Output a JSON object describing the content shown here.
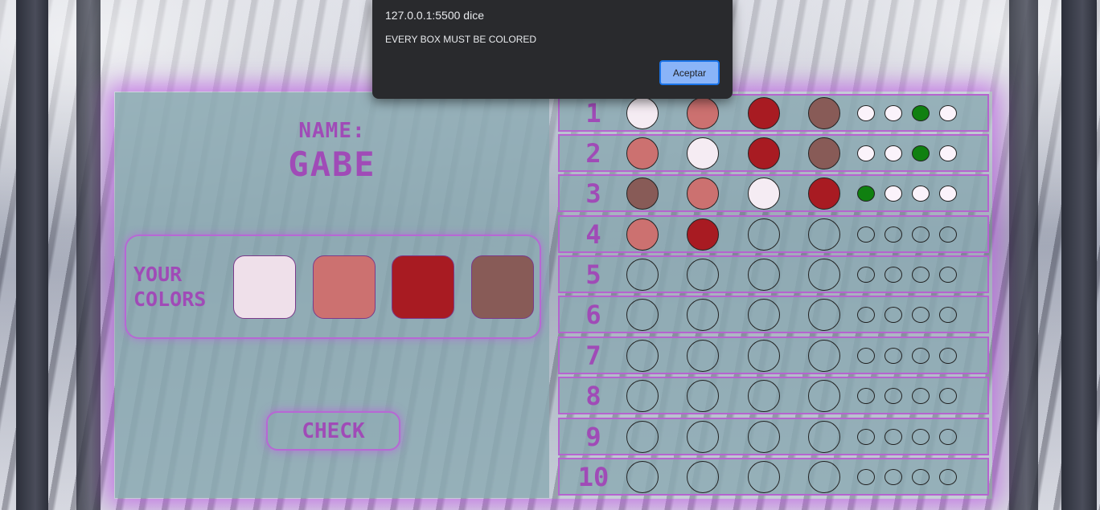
{
  "alert": {
    "title": "127.0.0.1:5500 dice",
    "message": "EVERY BOX MUST BE COLORED",
    "accept_label": "Aceptar"
  },
  "player": {
    "name_label": "NAME:",
    "name": "GABE"
  },
  "colors_panel": {
    "label_line1": "YOUR",
    "label_line2": "COLORS",
    "colors": [
      "#efe0ea",
      "#cc7170",
      "#a81b22",
      "#885b57"
    ]
  },
  "check_label": "CHECK",
  "palette": {
    "accent": "#a04bb7",
    "glow": "#be5ae6",
    "empty": "transparent",
    "white": "#f5ecf3",
    "pink": "#cc7170",
    "red": "#a81b22",
    "brown": "#885b57",
    "hint_white": "#fbf3fb",
    "hint_green": "#108010"
  },
  "rows": [
    {
      "num": "1",
      "pegs": [
        "white",
        "pink",
        "red",
        "brown"
      ],
      "hints": [
        "hint_white",
        "hint_white",
        "hint_green",
        "hint_white"
      ]
    },
    {
      "num": "2",
      "pegs": [
        "pink",
        "white",
        "red",
        "brown"
      ],
      "hints": [
        "hint_white",
        "hint_white",
        "hint_green",
        "hint_white"
      ]
    },
    {
      "num": "3",
      "pegs": [
        "brown",
        "pink",
        "white",
        "red"
      ],
      "hints": [
        "hint_green",
        "hint_white",
        "hint_white",
        "hint_white"
      ]
    },
    {
      "num": "4",
      "pegs": [
        "pink",
        "red",
        "empty",
        "empty"
      ],
      "hints": [
        "empty",
        "empty",
        "empty",
        "empty"
      ]
    },
    {
      "num": "5",
      "pegs": [
        "empty",
        "empty",
        "empty",
        "empty"
      ],
      "hints": [
        "empty",
        "empty",
        "empty",
        "empty"
      ]
    },
    {
      "num": "6",
      "pegs": [
        "empty",
        "empty",
        "empty",
        "empty"
      ],
      "hints": [
        "empty",
        "empty",
        "empty",
        "empty"
      ]
    },
    {
      "num": "7",
      "pegs": [
        "empty",
        "empty",
        "empty",
        "empty"
      ],
      "hints": [
        "empty",
        "empty",
        "empty",
        "empty"
      ]
    },
    {
      "num": "8",
      "pegs": [
        "empty",
        "empty",
        "empty",
        "empty"
      ],
      "hints": [
        "empty",
        "empty",
        "empty",
        "empty"
      ]
    },
    {
      "num": "9",
      "pegs": [
        "empty",
        "empty",
        "empty",
        "empty"
      ],
      "hints": [
        "empty",
        "empty",
        "empty",
        "empty"
      ]
    },
    {
      "num": "10",
      "pegs": [
        "empty",
        "empty",
        "empty",
        "empty"
      ],
      "hints": [
        "empty",
        "empty",
        "empty",
        "empty"
      ]
    }
  ]
}
